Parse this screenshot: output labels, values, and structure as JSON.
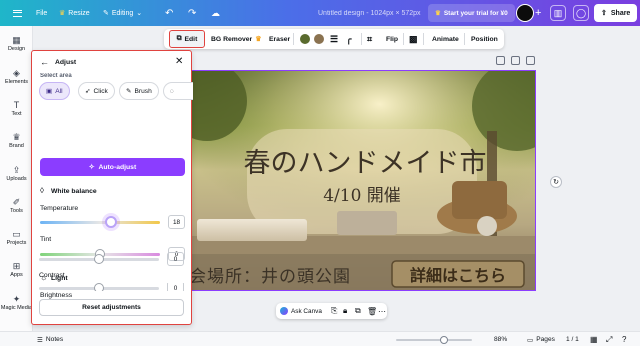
{
  "topbar": {
    "file": "File",
    "resize": "Resize",
    "editing": "Editing",
    "doc_title": "Untitled design - 1024px × 572px",
    "trial": "Start your trial for ¥0",
    "share": "Share"
  },
  "rail": {
    "items": [
      "Design",
      "Elements",
      "Text",
      "Brand",
      "Uploads",
      "Tools",
      "Projects",
      "Apps",
      "Magic Media"
    ]
  },
  "context_toolbar": {
    "edit": "Edit",
    "bg_remover": "BG Remover",
    "eraser": "Eraser",
    "flip": "Flip",
    "animate": "Animate",
    "position": "Position",
    "swatches": [
      "#5a6b2e",
      "#8a7250"
    ]
  },
  "adjust_panel": {
    "title": "Adjust",
    "select_area_label": "Select area",
    "modes": [
      "All",
      "Click",
      "Brush"
    ],
    "active_mode": "All",
    "auto_adjust": "Auto-adjust",
    "white_balance": "White balance",
    "temperature_label": "Temperature",
    "temperature_value": "18",
    "temperature_level": 0.59,
    "tint_label": "Tint",
    "tint_value": "0",
    "tint_level": 0.5,
    "light": "Light",
    "brightness_label": "Brightness",
    "brightness_value": "0",
    "brightness_level": 0.5,
    "contrast_label": "Contrast",
    "contrast_value": "0",
    "contrast_level": 0.5,
    "reset": "Reset adjustments"
  },
  "design": {
    "headline": "春のハンドメイド市",
    "date": "4/10 開催",
    "venue": "会場所：井の頭公園",
    "details_button": "詳細はこちら"
  },
  "askbar": {
    "ask": "Ask Canva"
  },
  "bottombar": {
    "notes": "Notes",
    "zoom": "88%",
    "pages": "Pages",
    "page_count": "1 / 1"
  },
  "colors": {
    "accent": "#8b3dff",
    "highlight": "#e0433f"
  }
}
